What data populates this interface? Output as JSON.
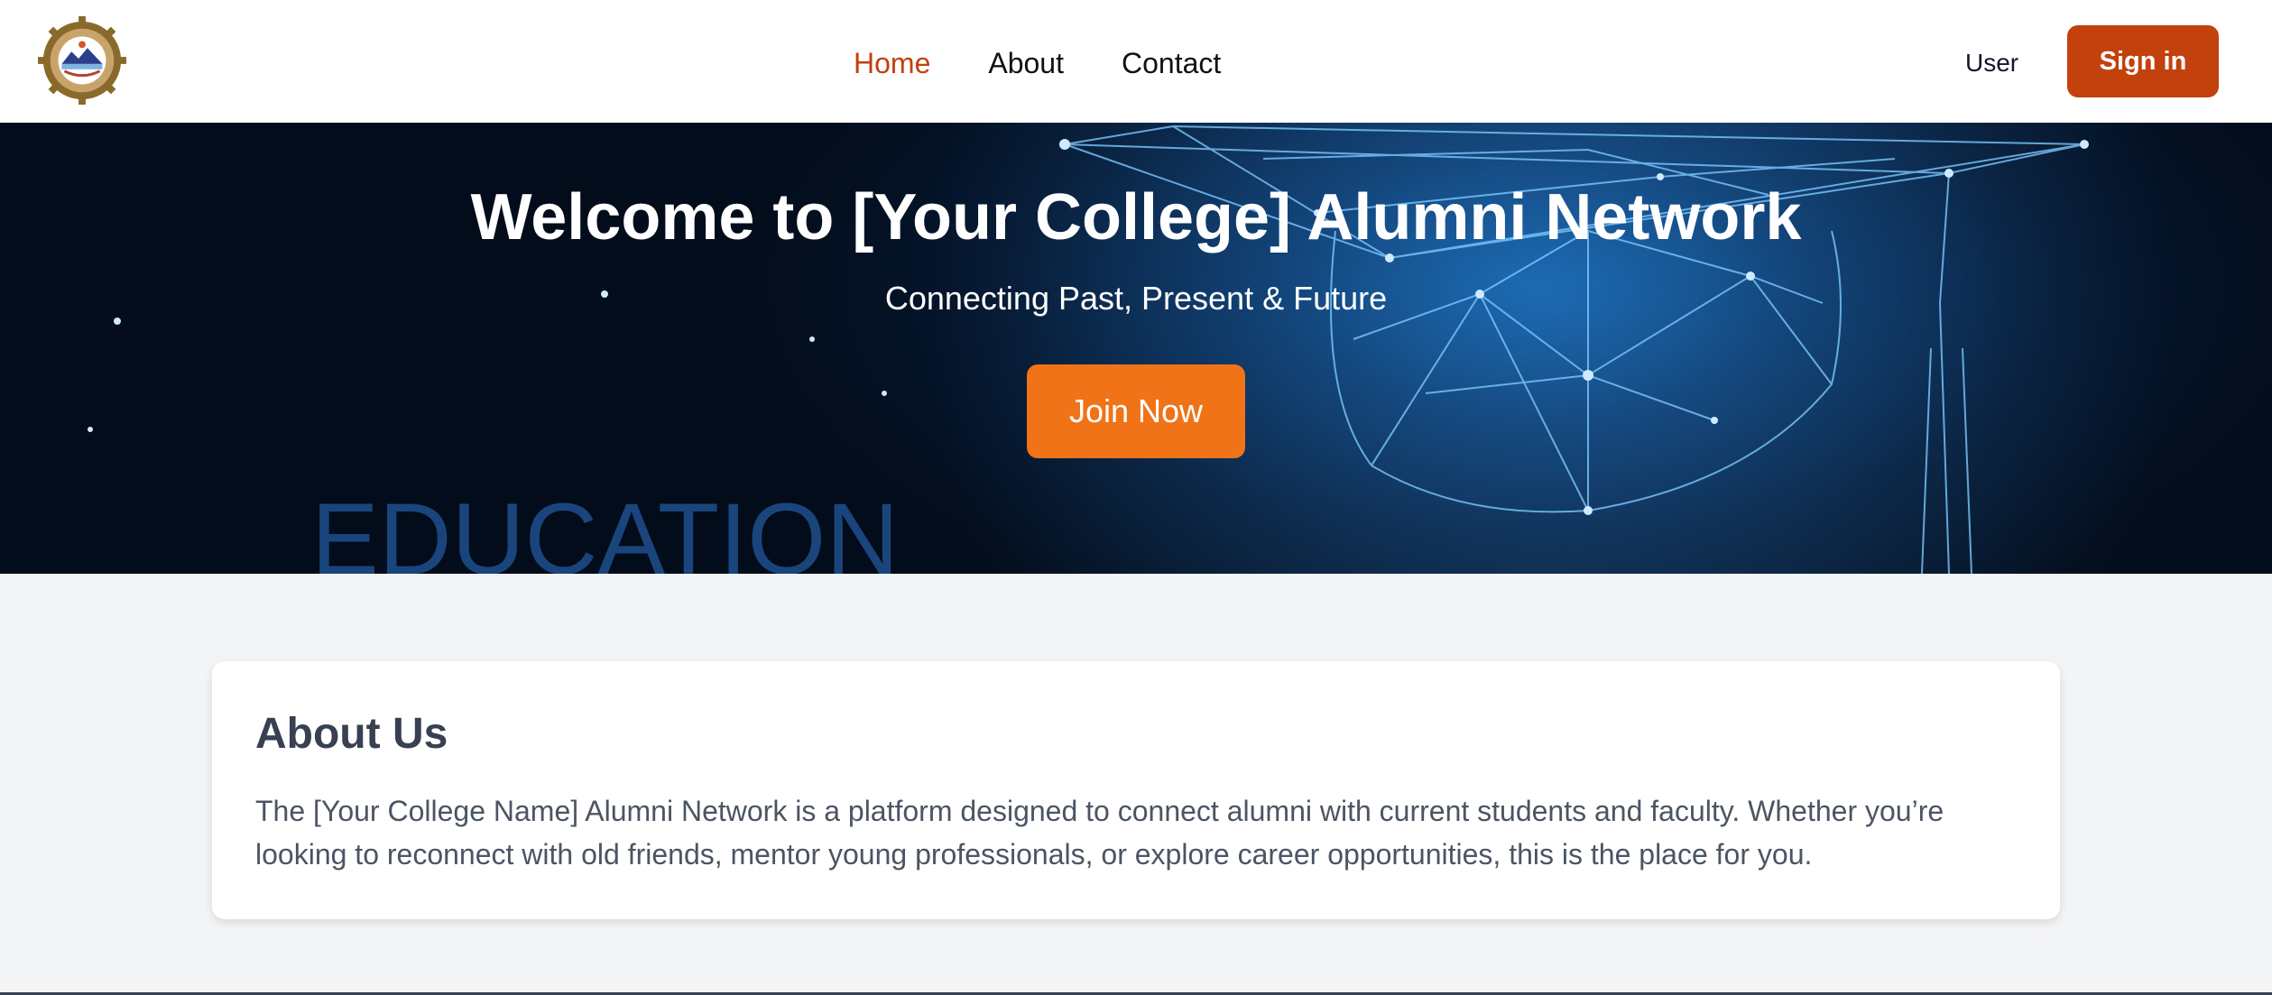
{
  "navbar": {
    "logo_alt": "College logo",
    "links": [
      {
        "label": "Home"
      },
      {
        "label": "About"
      },
      {
        "label": "Contact"
      }
    ],
    "user_label": "User",
    "signin_label": "Sign in"
  },
  "hero": {
    "title": "Welcome to [Your College] Alumni Network",
    "subtitle": "Connecting Past, Present & Future",
    "cta_label": "Join Now",
    "background_word": "EDUCATION"
  },
  "about": {
    "title": "About Us",
    "text": "The [Your College Name] Alumni Network is a platform designed to connect alumni with current students and faculty. Whether you’re looking to reconnect with old friends, mentor young professionals, or explore career opportunities, this is the place for you."
  },
  "colors": {
    "accent": "#c2410c",
    "cta": "#f07318",
    "page_bg": "#f3f4f6"
  }
}
